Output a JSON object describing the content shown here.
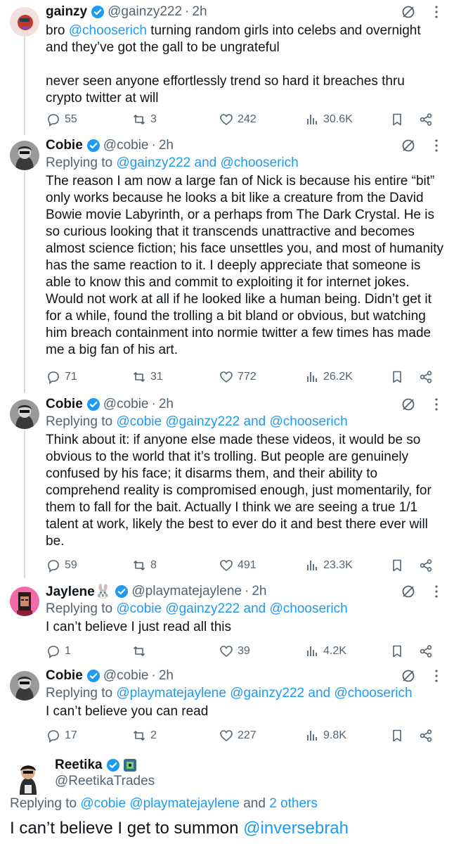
{
  "tweets": [
    {
      "name": "gainzy",
      "handle": "@gainzy222",
      "time": "2h",
      "body_pre": "bro ",
      "body_mention": "@chooserich",
      "body_post": " turning random girls into celebs and overnight and they’ve got the gall to be ungrateful",
      "body_p2": "never seen anyone effortlessly trend so hard it breaches thru crypto twitter at will",
      "replies": "55",
      "retweets": "3",
      "likes": "242",
      "views": "30.6K"
    },
    {
      "name": "Cobie",
      "handle": "@cobie",
      "time": "2h",
      "replying_prefix": "Replying to",
      "replying_to": "@gainzy222 and @chooserich",
      "body": "The reason I am now a large fan of Nick is because his entire “bit” only works because he looks a bit like a creature from the David Bowie movie Labyrinth, or a perhaps from The Dark Crystal. He is so curious looking that it transcends unattractive and becomes almost science fiction; his face unsettles you, and most of humanity has the same reaction to it. I deeply appreciate that someone is able to know this and commit to exploiting it for internet jokes. Would not work at all if he looked like a human being. Didn’t get it for a while, found the trolling a bit bland or obvious, but watching him breach containment into normie twitter a few times has made me a big fan of his art.",
      "replies": "71",
      "retweets": "31",
      "likes": "772",
      "views": "26.2K"
    },
    {
      "name": "Cobie",
      "handle": "@cobie",
      "time": "2h",
      "replying_prefix": "Replying to",
      "replying_to": "@cobie @gainzy222 and @chooserich",
      "body": "Think about it: if anyone else made these videos, it would be so obvious to the world that it’s trolling. But people are genuinely confused by his face; it disarms them, and their ability to comprehend reality is compromised enough, just momentarily, for them to fall for the bait. Actually I think we are seeing a true 1/1 talent at work, likely the best to ever do it and best there ever will be.",
      "replies": "59",
      "retweets": "8",
      "likes": "491",
      "views": "23.3K"
    },
    {
      "name": "Jaylene🐰",
      "handle": "@playmatejaylene",
      "time": "2h",
      "replying_prefix": "Replying to",
      "replying_to": "@cobie @gainzy222 and @chooserich",
      "body": "I can’t believe I just read all this",
      "replies": "1",
      "retweets": "",
      "likes": "39",
      "views": "4.2K"
    },
    {
      "name": "Cobie",
      "handle": "@cobie",
      "time": "2h",
      "replying_prefix": "Replying to",
      "replying_to": "@playmatejaylene @gainzy222 and @chooserich",
      "body": "I can’t believe you can read",
      "replies": "17",
      "retweets": "2",
      "likes": "227",
      "views": "9.8K"
    }
  ],
  "main_tweet": {
    "name": "Reetika",
    "handle": "@ReetikaTrades",
    "replying_prefix": "Replying to",
    "replying_to": "@cobie @playmatejaylene",
    "replying_and": "and",
    "replying_others": "2 others",
    "body_pre": "I can’t believe I get to summon ",
    "body_mention": "@inversebrah"
  },
  "separator": "·",
  "colors": {
    "link": "#1d9bf0",
    "secondary": "#536471",
    "text": "#0f1419",
    "thread_line": "#cfd9de"
  },
  "icons": [
    "verified-badge-icon",
    "grok-icon",
    "more-icon",
    "reply-icon",
    "retweet-icon",
    "like-icon",
    "views-icon",
    "bookmark-icon",
    "share-icon",
    "special-badge-icon"
  ]
}
